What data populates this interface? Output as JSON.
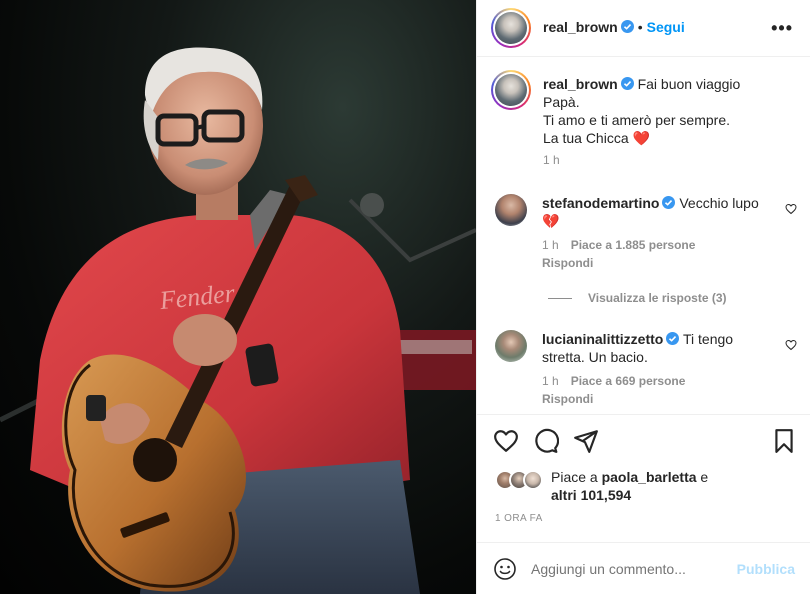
{
  "post": {
    "image_alt": "",
    "header": {
      "username": "real_brown",
      "separator": "•",
      "follow_label": "Segui",
      "more_icon": "more-horizontal-icon",
      "more_label": "•••"
    },
    "caption": {
      "username": "real_brown",
      "line1": "Fai buon viaggio",
      "line2": "Papà.",
      "line3": "Ti amo e ti amerò per sempre.",
      "line4": "La tua Chicca ",
      "emoji": "❤️",
      "time": "1 h"
    },
    "comments": [
      {
        "username": "stefanodemartino",
        "text_a": "Vecchio lupo",
        "text_b": "💔",
        "time": "1 h",
        "likes": "Piace a 1.885 persone",
        "reply_label": "Rispondi",
        "view_replies": "Visualizza le risposte (3)"
      },
      {
        "username": "lucianinalittizzetto",
        "text_a": "Ti tengo",
        "text_b": "stretta. Un bacio.",
        "time": "1 h",
        "likes": "Piace a 669 persone",
        "reply_label": "Rispondi"
      }
    ],
    "likes": {
      "prefix": "Piace a ",
      "user": "paola_barletta",
      "mid": " e",
      "others": "altri 101,594"
    },
    "timestamp": "1 ORA FA",
    "composer": {
      "placeholder": "Aggiungi un commento...",
      "publish_label": "Pubblica"
    }
  },
  "colors": {
    "accent": "#0095f6",
    "verified": "#3897f0",
    "muted": "#8e8e8e",
    "publish_disabled": "#b2dffc",
    "heart_red": "#ed4956",
    "shirt_red": "#d9393f"
  }
}
